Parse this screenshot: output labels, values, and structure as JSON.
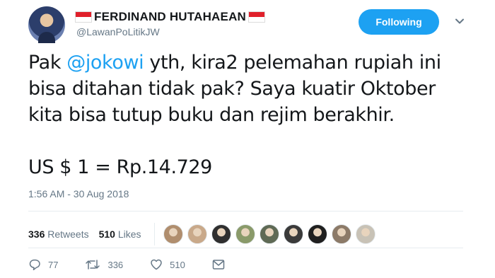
{
  "header": {
    "display_name": "FERDINAND HUTAHAEAN",
    "handle": "@LawanPoLitikJW",
    "follow_label": "Following"
  },
  "tweet": {
    "line1_prefix": "Pak ",
    "mention": "@jokowi",
    "line1_suffix": " yth, kira2 pelemahan rupiah ini",
    "line2": "bisa ditahan tidak pak? Saya kuatir Oktober",
    "line3": "kita bisa tutup buku dan rejim berakhir.",
    "line5": "US $ 1 = Rp.14.729"
  },
  "timestamp": "1:56 AM - 30 Aug 2018",
  "stats": {
    "retweets_count": "336",
    "retweets_label": "Retweets",
    "likes_count": "510",
    "likes_label": "Likes"
  },
  "likers": [
    "#b08e6e",
    "#c9a98a",
    "#2f2f2f",
    "#8a9a6a",
    "#5f6a55",
    "#3a3a3a",
    "#1f1f1f",
    "#8c7a68",
    "#c8c2b6"
  ],
  "actions": {
    "replies": "77",
    "retweets": "336",
    "likes": "510"
  },
  "colors": {
    "accent": "#1da1f2",
    "muted": "#657786",
    "flag_red": "#e0202b"
  }
}
